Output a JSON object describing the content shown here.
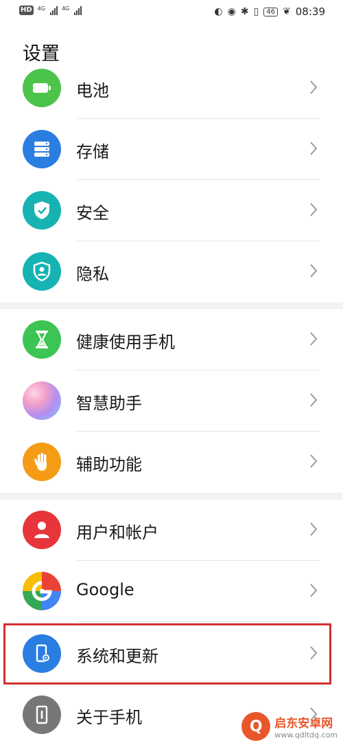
{
  "status_bar": {
    "hd": "HD",
    "net1": "4G",
    "net2": "4G",
    "battery": "46",
    "time": "08:39"
  },
  "page": {
    "title": "设置"
  },
  "items": [
    {
      "label": "电池",
      "icon": "battery-icon",
      "color": "#4cc44c"
    },
    {
      "label": "存储",
      "icon": "storage-icon",
      "color": "#2a7de1"
    },
    {
      "label": "安全",
      "icon": "shield-icon",
      "color": "#17b3b3"
    },
    {
      "label": "隐私",
      "icon": "privacy-icon",
      "color": "#17b3b3"
    },
    {
      "label": "健康使用手机",
      "icon": "hourglass-icon",
      "color": "#3cc454"
    },
    {
      "label": "智慧助手",
      "icon": "assistant-icon",
      "color": "#c98be8"
    },
    {
      "label": "辅助功能",
      "icon": "hand-icon",
      "color": "#f59b16"
    },
    {
      "label": "用户和帐户",
      "icon": "user-icon",
      "color": "#e8353b"
    },
    {
      "label": "Google",
      "icon": "google-icon",
      "color": "#4285f4"
    },
    {
      "label": "系统和更新",
      "icon": "system-update-icon",
      "color": "#2a7de1"
    },
    {
      "label": "关于手机",
      "icon": "phone-info-icon",
      "color": "#777777"
    }
  ],
  "watermark": {
    "title": "启东安卓网",
    "url": "www.qdltdq.com",
    "logo": "Q"
  }
}
